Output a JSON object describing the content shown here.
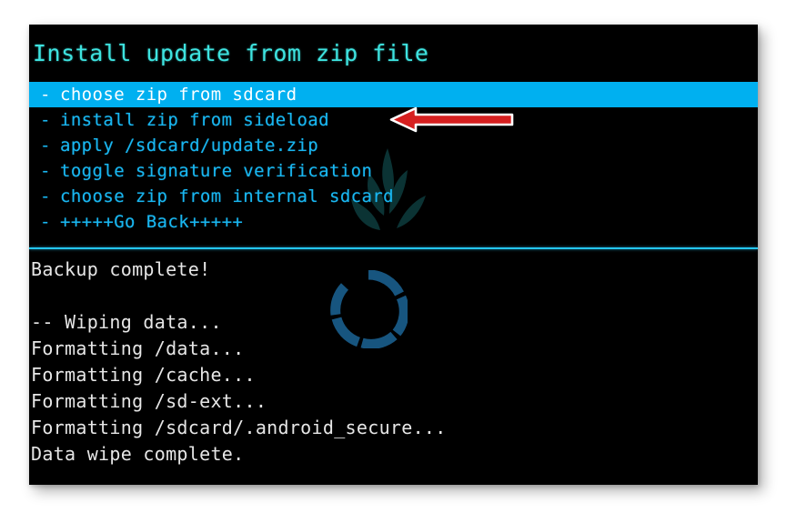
{
  "screen": {
    "title": "Install update from zip file",
    "background_color": "#000000",
    "title_color": "#3ee3e0",
    "accent_color": "#19b6f0",
    "highlight_color": "#00b0f0",
    "divider_color": "#24c6f5",
    "log_text_color": "#e6e6e6",
    "spinner_color": "#17557f",
    "arrow_color": "#d61f1f",
    "arrow_outline_color": "#ffffff",
    "watermark_color": "#1b6d72"
  },
  "menu": {
    "bullet": "-",
    "selected_index": 0,
    "items": [
      {
        "label": "choose zip from sdcard",
        "selected": true
      },
      {
        "label": "install zip from sideload",
        "selected": false
      },
      {
        "label": "apply /sdcard/update.zip",
        "selected": false
      },
      {
        "label": "toggle signature verification",
        "selected": false
      },
      {
        "label": "choose zip from internal sdcard",
        "selected": false
      },
      {
        "label": "+++++Go Back+++++",
        "selected": false
      }
    ]
  },
  "log": {
    "lines": [
      "Backup complete!",
      "",
      "-- Wiping data...",
      "Formatting /data...",
      "Formatting /cache...",
      "Formatting /sd-ext...",
      "Formatting /sdcard/.android_secure...",
      "Data wipe complete."
    ]
  },
  "annotation": {
    "arrow_direction": "left",
    "points_at": "choose zip from sdcard"
  }
}
